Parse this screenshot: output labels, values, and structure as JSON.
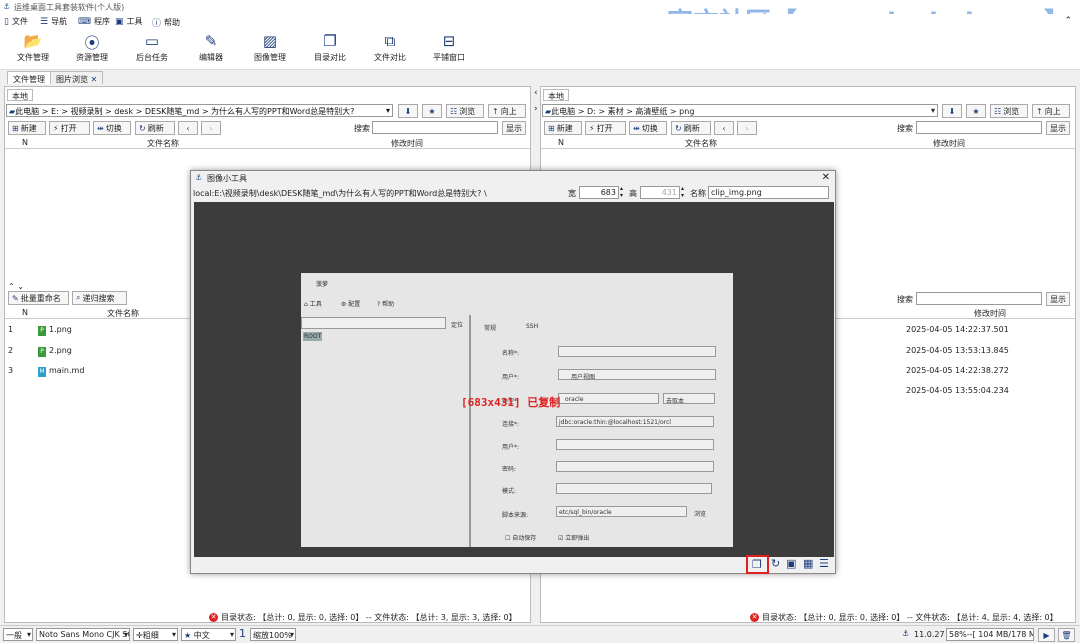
{
  "app": {
    "title": "运维桌面工具套装软件(个人版)",
    "watermark": "官方社区【www.deskui.com】"
  },
  "menu": [
    "文件",
    "导航",
    "程序",
    "工具",
    "帮助"
  ],
  "toolbar": [
    "文件管理",
    "资源管理",
    "后台任务",
    "编辑器",
    "图像管理",
    "目录对比",
    "文件对比",
    "平铺窗口"
  ],
  "tabs": [
    "文件管理",
    "图片浏览"
  ],
  "left": {
    "tab": "本地",
    "path": "此电脑 > E: > 视频录制 > desk > DESK随笔_md > 为什么有人写的PPT和Word总是特别大?",
    "browse": "浏览",
    "up": "向上",
    "new": "新建",
    "open": "打开",
    "switch": "切换",
    "refresh": "刷新",
    "search_label": "搜索",
    "show": "显示",
    "col_n": "N",
    "col_name": "文件名称",
    "col_time": "修改时间",
    "batch_rename": "批量重命名",
    "recursive_search": "递归搜索",
    "files": [
      {
        "n": "1",
        "name": "1.png"
      },
      {
        "n": "2",
        "name": "2.png"
      },
      {
        "n": "3",
        "name": "main.md"
      }
    ],
    "status": "目录状态: 【总计: 0, 显示: 0, 选择: 0】 -- 文件状态: 【总计: 3, 显示: 3, 选择: 0】"
  },
  "right": {
    "tab": "本地",
    "path": "此电脑 > D: > 素材 > 高清壁纸 > png",
    "browse": "浏览",
    "up": "向上",
    "new": "新建",
    "open": "打开",
    "switch": "切换",
    "refresh": "刷新",
    "search_label": "搜索",
    "show": "显示",
    "col_n": "N",
    "col_name": "文件名称",
    "col_time": "修改时间",
    "times": [
      "2025-04-05 14:22:37.501",
      "2025-04-05 13:53:13.845",
      "2025-04-05 14:22:38.272",
      "2025-04-05 13:55:04.234"
    ],
    "status": "目录状态: 【总计: 0, 显示: 0, 选择: 0】 -- 文件状态: 【总计: 4, 显示: 4, 选择: 0】"
  },
  "dialog": {
    "title": "图像小工具",
    "path": "local:E:\\视频录制\\desk\\DESK随笔_md\\为什么有人写的PPT和Word总是特别大? \\",
    "width_label": "宽",
    "width": "683",
    "height_label": "高",
    "height": "431",
    "name_label": "名称",
    "name": "clip_img.png",
    "copied_msg": "[683x431] 已复制"
  },
  "photo": {
    "title": "菠萝",
    "tool": "工具",
    "config": "配置",
    "help": "帮助",
    "locate": "定位",
    "tab_general": "常规",
    "tab_ssh": "SSH",
    "root": "ROOT",
    "labels": [
      "名称*:",
      "用户*:",
      "类型*:",
      "连接*:",
      "用户*:",
      "密码:",
      "模式:",
      "脚本来源:"
    ],
    "user_group": "用户视图",
    "oracle": "oracle",
    "default": "去取本",
    "conn": "jdbc:oracle:thin:@localhost:1521/orcl",
    "script": "etc/sql_bin/oracle",
    "browse": "浏览",
    "auto_save": "自动保存",
    "new_window": "立即弹出"
  },
  "bottom": {
    "mode": "一般",
    "font": "Noto Sans Mono CJK SC",
    "weight": "粗细",
    "lang": "中文",
    "num": "1",
    "zoom": "缩放100%",
    "version": "11.0.27",
    "memory": "58%--[ 104 MB/178 MB ]"
  }
}
